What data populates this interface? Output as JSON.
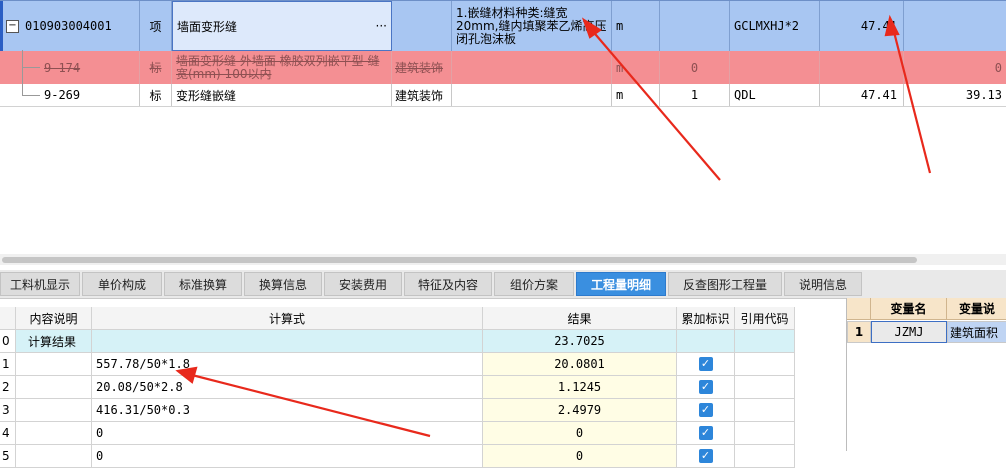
{
  "top_grid": {
    "rows": [
      {
        "code": "010903004001",
        "type": "项",
        "name": "墙面变形缝",
        "name_more": "···",
        "feature": "1.嵌缝材料种类:缝宽20mm,缝内填聚苯乙烯高压闭孔泡沫板",
        "unit": "m",
        "expression": "GCLMXHJ*2",
        "quantity": "47.41"
      },
      {
        "code": "9-174",
        "type": "标",
        "name": "墙面变形缝 外墙面 橡胶双列嵌平型 缝宽(mm) 100以内",
        "category": "建筑装饰",
        "feature": "",
        "unit": "m",
        "amount": "0",
        "expression": "",
        "quantity": "",
        "price": "0"
      },
      {
        "code": "9-269",
        "type": "标",
        "name": "变形缝嵌缝",
        "category": "建筑装饰",
        "feature": "",
        "unit": "m",
        "amount": "1",
        "expression": "QDL",
        "quantity": "47.41",
        "price": "39.13"
      }
    ]
  },
  "tabs": [
    {
      "label": "工料机显示",
      "active": false
    },
    {
      "label": "单价构成",
      "active": false
    },
    {
      "label": "标准换算",
      "active": false
    },
    {
      "label": "换算信息",
      "active": false
    },
    {
      "label": "安装费用",
      "active": false
    },
    {
      "label": "特征及内容",
      "active": false
    },
    {
      "label": "组价方案",
      "active": false
    },
    {
      "label": "工程量明细",
      "active": true
    },
    {
      "label": "反查图形工程量",
      "active": false
    },
    {
      "label": "说明信息",
      "active": false
    }
  ],
  "detail_grid": {
    "headers": [
      "内容说明",
      "计算式",
      "结果",
      "累加标识",
      "引用代码"
    ],
    "rows": [
      {
        "idx": "0",
        "desc": "计算结果",
        "formula": "",
        "result": "23.7025",
        "checked": false
      },
      {
        "idx": "1",
        "desc": "",
        "formula": "557.78/50*1.8",
        "result": "20.0801",
        "checked": true
      },
      {
        "idx": "2",
        "desc": "",
        "formula": "20.08/50*2.8",
        "result": "1.1245",
        "checked": true
      },
      {
        "idx": "3",
        "desc": "",
        "formula": "416.31/50*0.3",
        "result": "2.4979",
        "checked": true
      },
      {
        "idx": "4",
        "desc": "",
        "formula": "0",
        "result": "0",
        "checked": true
      },
      {
        "idx": "5",
        "desc": "",
        "formula": "0",
        "result": "0",
        "checked": true
      }
    ]
  },
  "var_panel": {
    "headers": [
      "变量名",
      "变量说"
    ],
    "rows": [
      {
        "idx": "1",
        "name": "JZMJ",
        "desc": "建筑面积"
      }
    ]
  },
  "colors": {
    "selected_row": "#a8c6f2",
    "deleted_row": "#f48f93",
    "active_tab": "#3a8fe0",
    "annotation_arrow": "#e8291c"
  }
}
